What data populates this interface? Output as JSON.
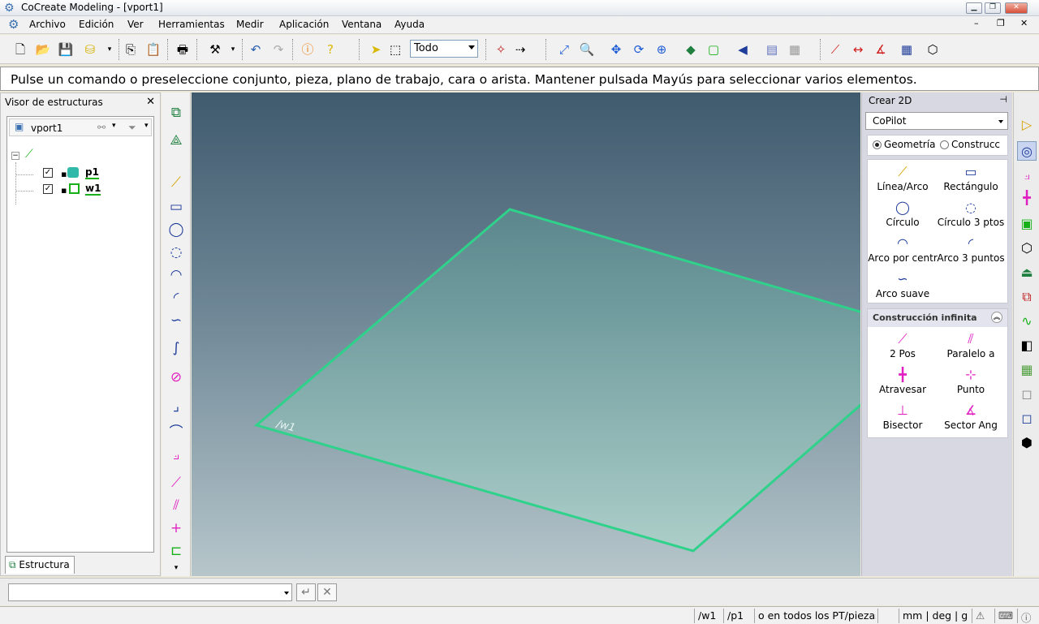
{
  "window": {
    "title": "CoCreate Modeling - [vport1]"
  },
  "menu": {
    "items": [
      "Archivo",
      "Edición",
      "Ver",
      "Herramientas",
      "Medir",
      "Aplicación",
      "Ventana",
      "Ayuda"
    ]
  },
  "toolbar": {
    "selection_filter": "Todo"
  },
  "prompt": {
    "text": "Pulse un comando o preseleccione conjunto, pieza, plano de trabajo, cara o arista. Mantener pulsada Mayús para seleccionar varios elementos."
  },
  "structure_viewer": {
    "title": "Visor de estructuras",
    "viewport_name": "vport1",
    "items": [
      {
        "label": "p1",
        "checked": true
      },
      {
        "label": "w1",
        "checked": true
      }
    ],
    "tab_label": "Estructura"
  },
  "viewport": {
    "workplane_label": "/w1",
    "colors": {
      "workplane_edge": "#2fd28a",
      "workplane_fill": "#7fd6b8"
    }
  },
  "create2d": {
    "title": "Crear 2D",
    "copilot": "CoPilot",
    "radio_geometry": "Geometría",
    "radio_construction": "Construcc",
    "geometry_items": [
      "Línea/Arco",
      "Rectángulo",
      "Círculo",
      "Círculo 3 ptos",
      "Arco por centr",
      "Arco 3 puntos",
      "Arco suave"
    ],
    "infinite_title": "Construcción infinita",
    "infinite_items": [
      "2 Pos",
      "Paralelo a",
      "Atravesar",
      "Punto",
      "Bisector",
      "Sector Ang"
    ]
  },
  "statusbar": {
    "workplane": "/w1",
    "part": "/p1",
    "scope": "o en todos los PT/piezas",
    "units": "mm | deg | g"
  },
  "colors": {
    "accent": "#1e5bd8",
    "magenta": "#e020c0",
    "green": "#18b018"
  }
}
